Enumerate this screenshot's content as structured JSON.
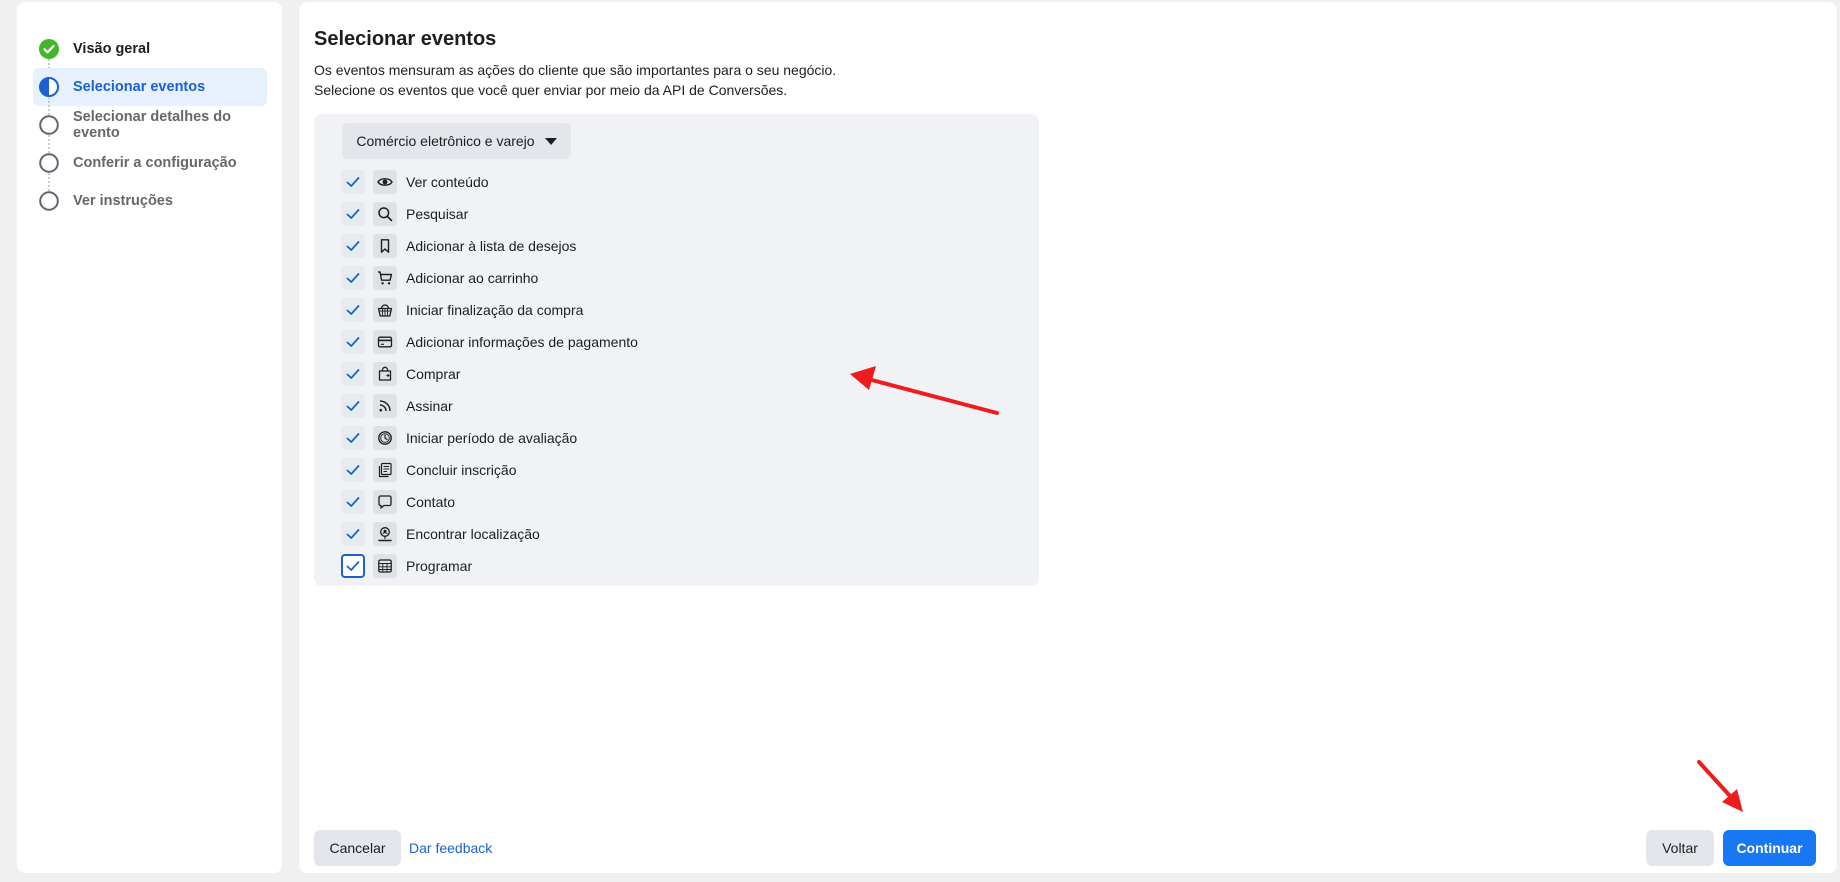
{
  "sidebar": {
    "steps": [
      {
        "label": "Visão geral",
        "state": "done"
      },
      {
        "label": "Selecionar eventos",
        "state": "active"
      },
      {
        "label": "Selecionar detalhes do evento",
        "state": "pending"
      },
      {
        "label": "Conferir a configuração",
        "state": "pending"
      },
      {
        "label": "Ver instruções",
        "state": "pending"
      }
    ]
  },
  "main": {
    "title": "Selecionar eventos",
    "description_line1": "Os eventos mensuram as ações do cliente que são importantes para o seu negócio.",
    "description_line2": "Selecione os eventos que você quer enviar por meio da API de Conversões.",
    "category_dropdown": "Comércio eletrônico e varejo",
    "events": [
      {
        "label": "Ver conteúdo",
        "icon": "eye-icon",
        "checked": true
      },
      {
        "label": "Pesquisar",
        "icon": "search-icon",
        "checked": true
      },
      {
        "label": "Adicionar à lista de desejos",
        "icon": "bookmark-icon",
        "checked": true
      },
      {
        "label": "Adicionar ao carrinho",
        "icon": "cart-icon",
        "checked": true
      },
      {
        "label": "Iniciar finalização da compra",
        "icon": "basket-icon",
        "checked": true
      },
      {
        "label": "Adicionar informações de pagamento",
        "icon": "credit-card-icon",
        "checked": true
      },
      {
        "label": "Comprar",
        "icon": "shopping-bag-icon",
        "checked": true
      },
      {
        "label": "Assinar",
        "icon": "rss-icon",
        "checked": true
      },
      {
        "label": "Iniciar período de avaliação",
        "icon": "clock-icon",
        "checked": true
      },
      {
        "label": "Concluir inscrição",
        "icon": "form-icon",
        "checked": true
      },
      {
        "label": "Contato",
        "icon": "chat-bubble-icon",
        "checked": true
      },
      {
        "label": "Encontrar localização",
        "icon": "location-pin-icon",
        "checked": true
      },
      {
        "label": "Programar",
        "icon": "calendar-grid-icon",
        "checked": true
      }
    ]
  },
  "footer": {
    "cancel_label": "Cancelar",
    "feedback_label": "Dar feedback",
    "back_label": "Voltar",
    "continue_label": "Continuar"
  },
  "colors": {
    "accent": "#1877f2",
    "active_step_bg": "#e7f0fd",
    "done_green": "#42b72a",
    "annotation_red": "#ee1c1c"
  }
}
